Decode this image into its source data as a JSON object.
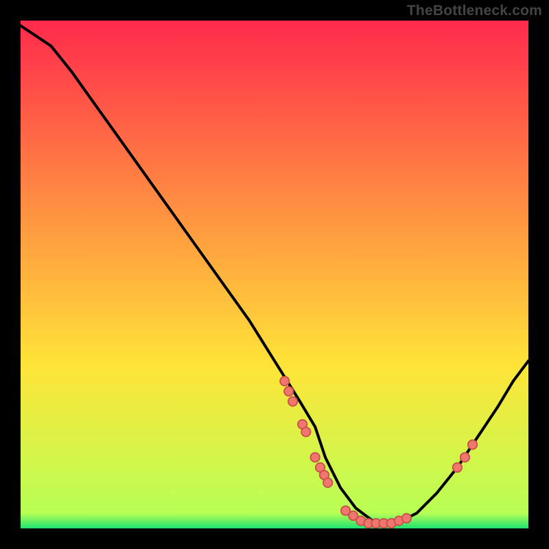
{
  "watermark": "TheBottleneck.com",
  "colors": {
    "background": "#000000",
    "curve": "#000000",
    "dot_fill": "#f0776f",
    "dot_stroke": "#c94f48",
    "gradient_top": "#ff2a4c",
    "gradient_mid": "#ffe438",
    "gradient_bottom": "#1de36f"
  },
  "chart_data": {
    "type": "line",
    "title": "",
    "xlabel": "",
    "ylabel": "",
    "xlim": [
      0,
      100
    ],
    "ylim": [
      0,
      100
    ],
    "grid": false,
    "annotations": [],
    "series": [
      {
        "name": "curve",
        "x": [
          0,
          3,
          6,
          10,
          15,
          20,
          25,
          30,
          35,
          40,
          45,
          50,
          55,
          58,
          60,
          63,
          66,
          70,
          74,
          78,
          82,
          86,
          90,
          94,
          97,
          100
        ],
        "y": [
          99,
          97,
          95,
          90,
          83,
          76,
          69,
          62,
          55,
          48,
          41,
          33,
          25,
          20,
          14,
          8,
          4,
          1,
          1,
          3,
          7,
          12,
          18,
          24,
          29,
          33
        ]
      }
    ],
    "points": [
      {
        "name": "left-cluster-upper",
        "x": 52.0,
        "y": 29.0
      },
      {
        "name": "left-cluster-upper",
        "x": 52.8,
        "y": 27.0
      },
      {
        "name": "left-cluster-upper",
        "x": 53.6,
        "y": 25.0
      },
      {
        "name": "left-cluster-mid",
        "x": 55.5,
        "y": 20.5
      },
      {
        "name": "left-cluster-mid",
        "x": 56.2,
        "y": 19.0
      },
      {
        "name": "left-cluster-low",
        "x": 58.0,
        "y": 14.0
      },
      {
        "name": "left-cluster-low",
        "x": 59.0,
        "y": 12.0
      },
      {
        "name": "left-cluster-low",
        "x": 59.8,
        "y": 10.5
      },
      {
        "name": "left-cluster-low",
        "x": 60.5,
        "y": 9.0
      },
      {
        "name": "bottom-cluster",
        "x": 64.0,
        "y": 3.5
      },
      {
        "name": "bottom-cluster",
        "x": 65.5,
        "y": 2.5
      },
      {
        "name": "bottom-cluster",
        "x": 67.0,
        "y": 1.5
      },
      {
        "name": "bottom-cluster",
        "x": 68.5,
        "y": 1.0
      },
      {
        "name": "bottom-cluster",
        "x": 70.0,
        "y": 1.0
      },
      {
        "name": "bottom-cluster",
        "x": 71.5,
        "y": 1.0
      },
      {
        "name": "bottom-cluster",
        "x": 73.0,
        "y": 1.0
      },
      {
        "name": "bottom-cluster",
        "x": 74.5,
        "y": 1.5
      },
      {
        "name": "bottom-cluster",
        "x": 76.0,
        "y": 2.0
      },
      {
        "name": "right-cluster",
        "x": 86.0,
        "y": 12.0
      },
      {
        "name": "right-cluster",
        "x": 87.5,
        "y": 14.0
      },
      {
        "name": "right-cluster",
        "x": 89.0,
        "y": 16.5
      }
    ]
  }
}
